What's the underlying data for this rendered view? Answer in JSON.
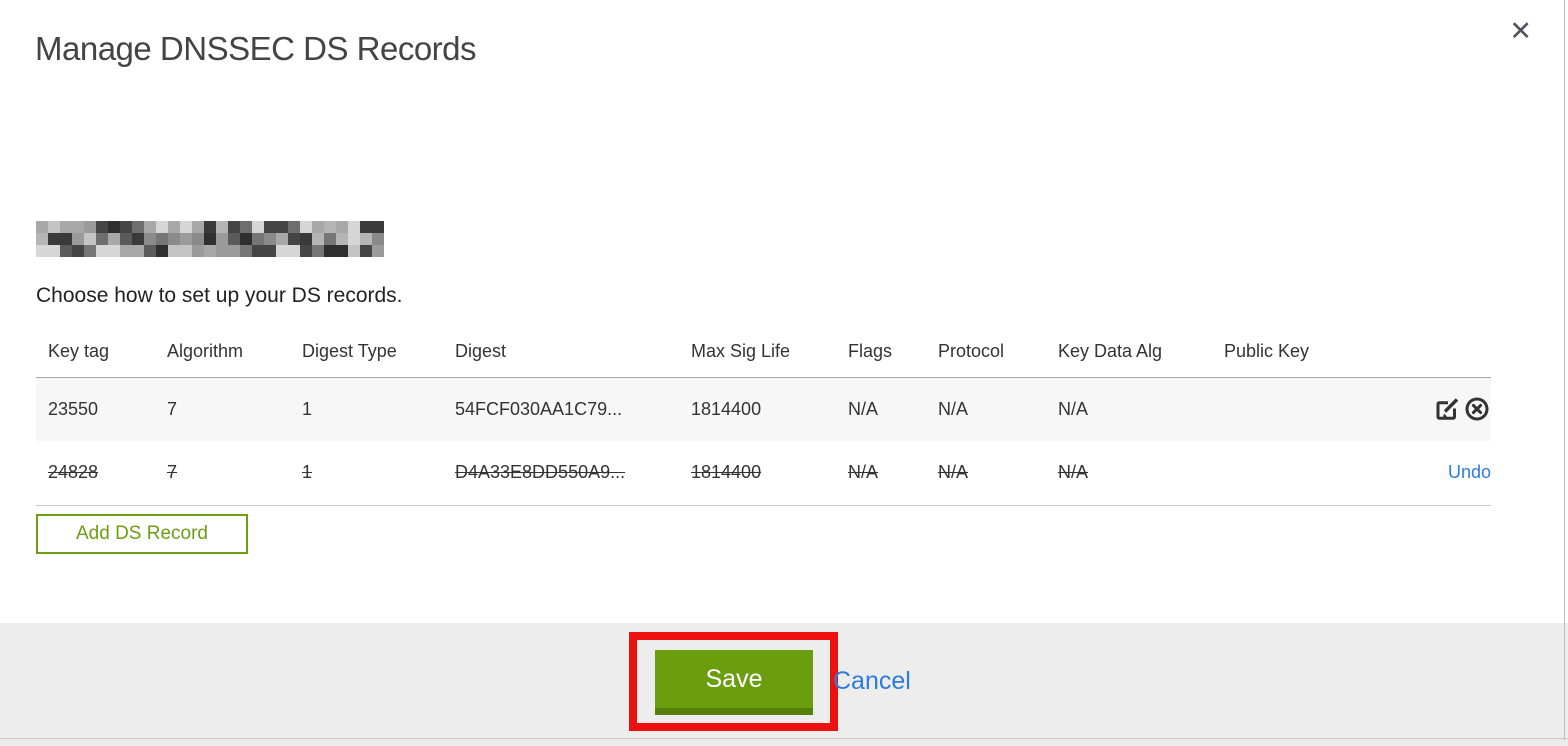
{
  "dialog": {
    "title": "Manage DNSSEC DS Records",
    "close_glyph": "✕",
    "domain_redacted": true,
    "subtitle": "Choose how to set up your DS records."
  },
  "table": {
    "headers": [
      "Key tag",
      "Algorithm",
      "Digest Type",
      "Digest",
      "Max Sig Life",
      "Flags",
      "Protocol",
      "Key Data Alg",
      "Public Key"
    ],
    "rows": [
      {
        "key_tag": "23550",
        "algorithm": "7",
        "digest_type": "1",
        "digest": "54FCF030AA1C79...",
        "max_sig_life": "1814400",
        "flags": "N/A",
        "protocol": "N/A",
        "key_data_alg": "N/A",
        "public_key": "",
        "state": "active",
        "actions": [
          "edit",
          "delete"
        ]
      },
      {
        "key_tag": "24828",
        "algorithm": "7",
        "digest_type": "1",
        "digest": "D4A33E8DD550A9...",
        "max_sig_life": "1814400",
        "flags": "N/A",
        "protocol": "N/A",
        "key_data_alg": "N/A",
        "public_key": "",
        "state": "pending-delete",
        "action_label": "Undo"
      }
    ]
  },
  "buttons": {
    "add_ds_record": "Add DS Record",
    "save": "Save",
    "cancel": "Cancel"
  },
  "icons": {
    "close": "x-close",
    "edit": "pencil-square",
    "delete": "circle-x"
  },
  "colors": {
    "accent_green": "#6b9e10",
    "save_green": "#6b9e0f",
    "save_green_dark": "#56800a",
    "link_blue": "#2b7be0",
    "annotation_red": "#ee1111",
    "footer_bg": "#ededed",
    "row_highlight": "#f7f7f7"
  }
}
